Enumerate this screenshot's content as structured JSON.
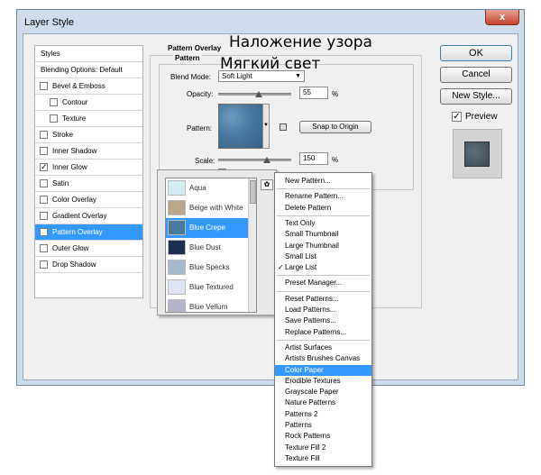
{
  "window": {
    "title": "Layer Style",
    "close_glyph": "x"
  },
  "styles_panel": {
    "header": "Styles",
    "blending": "Blending Options: Default",
    "items": [
      {
        "label": "Bevel & Emboss",
        "checked": false,
        "indent": false
      },
      {
        "label": "Contour",
        "checked": false,
        "indent": true
      },
      {
        "label": "Texture",
        "checked": false,
        "indent": true
      },
      {
        "label": "Stroke",
        "checked": false,
        "indent": false
      },
      {
        "label": "Inner Shadow",
        "checked": false,
        "indent": false
      },
      {
        "label": "Inner Glow",
        "checked": true,
        "indent": false
      },
      {
        "label": "Satin",
        "checked": false,
        "indent": false
      },
      {
        "label": "Color Overlay",
        "checked": false,
        "indent": false
      },
      {
        "label": "Gradient Overlay",
        "checked": false,
        "indent": false
      },
      {
        "label": "Pattern Overlay",
        "checked": true,
        "indent": false,
        "selected": true
      },
      {
        "label": "Outer Glow",
        "checked": false,
        "indent": false
      },
      {
        "label": "Drop Shadow",
        "checked": false,
        "indent": false
      }
    ]
  },
  "pattern_overlay": {
    "section_title": "Pattern Overlay",
    "group_title": "Pattern",
    "blend_mode_label": "Blend Mode:",
    "blend_mode_value": "Soft Light",
    "opacity_label": "Opacity:",
    "opacity_value": "55",
    "opacity_fraction": 0.55,
    "pattern_label": "Pattern:",
    "snap_button": "Snap to Origin",
    "scale_label": "Scale:",
    "scale_value": "150",
    "percent": "%"
  },
  "russian": {
    "line1": "Наложение узора",
    "line2": "Мягкий свет"
  },
  "buttons": {
    "ok": "OK",
    "cancel": "Cancel",
    "new_style": "New Style...",
    "preview_label": "Preview",
    "preview_checked": true
  },
  "pattern_picker": {
    "items": [
      {
        "label": "Aqua",
        "color": "#d6ecf3"
      },
      {
        "label": "Beige with White",
        "color": "#b9a78c"
      },
      {
        "label": "Blue Crepe",
        "color": "#4a7aa0",
        "selected": true
      },
      {
        "label": "Blue Dust",
        "color": "#1e2e52"
      },
      {
        "label": "Blue Specks",
        "color": "#a8b8cc"
      },
      {
        "label": "Blue Textured",
        "color": "#dfe4f5"
      },
      {
        "label": "Blue Vellum",
        "color": "#b4b4c8"
      }
    ]
  },
  "menu": {
    "items": [
      {
        "label": "New Pattern..."
      },
      {
        "sep": true
      },
      {
        "label": "Rename Pattern..."
      },
      {
        "label": "Delete Pattern"
      },
      {
        "sep": true
      },
      {
        "label": "Text Only"
      },
      {
        "label": "Small Thumbnail"
      },
      {
        "label": "Large Thumbnail"
      },
      {
        "label": "Small List"
      },
      {
        "label": "Large List",
        "checked": true
      },
      {
        "sep": true
      },
      {
        "label": "Preset Manager..."
      },
      {
        "sep": true
      },
      {
        "label": "Reset Patterns..."
      },
      {
        "label": "Load Patterns..."
      },
      {
        "label": "Save Patterns..."
      },
      {
        "label": "Replace Patterns..."
      },
      {
        "sep": true
      },
      {
        "label": "Artist Surfaces"
      },
      {
        "label": "Artists Brushes Canvas"
      },
      {
        "label": "Color Paper",
        "selected": true
      },
      {
        "label": "Erodible Textures"
      },
      {
        "label": "Grayscale Paper"
      },
      {
        "label": "Nature Patterns"
      },
      {
        "label": "Patterns 2"
      },
      {
        "label": "Patterns"
      },
      {
        "label": "Rock Patterns"
      },
      {
        "label": "Texture Fill 2"
      },
      {
        "label": "Texture Fill"
      }
    ],
    "check_glyph": "✓"
  },
  "colors": {
    "selection": "#3399ff",
    "window_frame": "#cfdcec",
    "client_bg": "#f0f0f0"
  }
}
